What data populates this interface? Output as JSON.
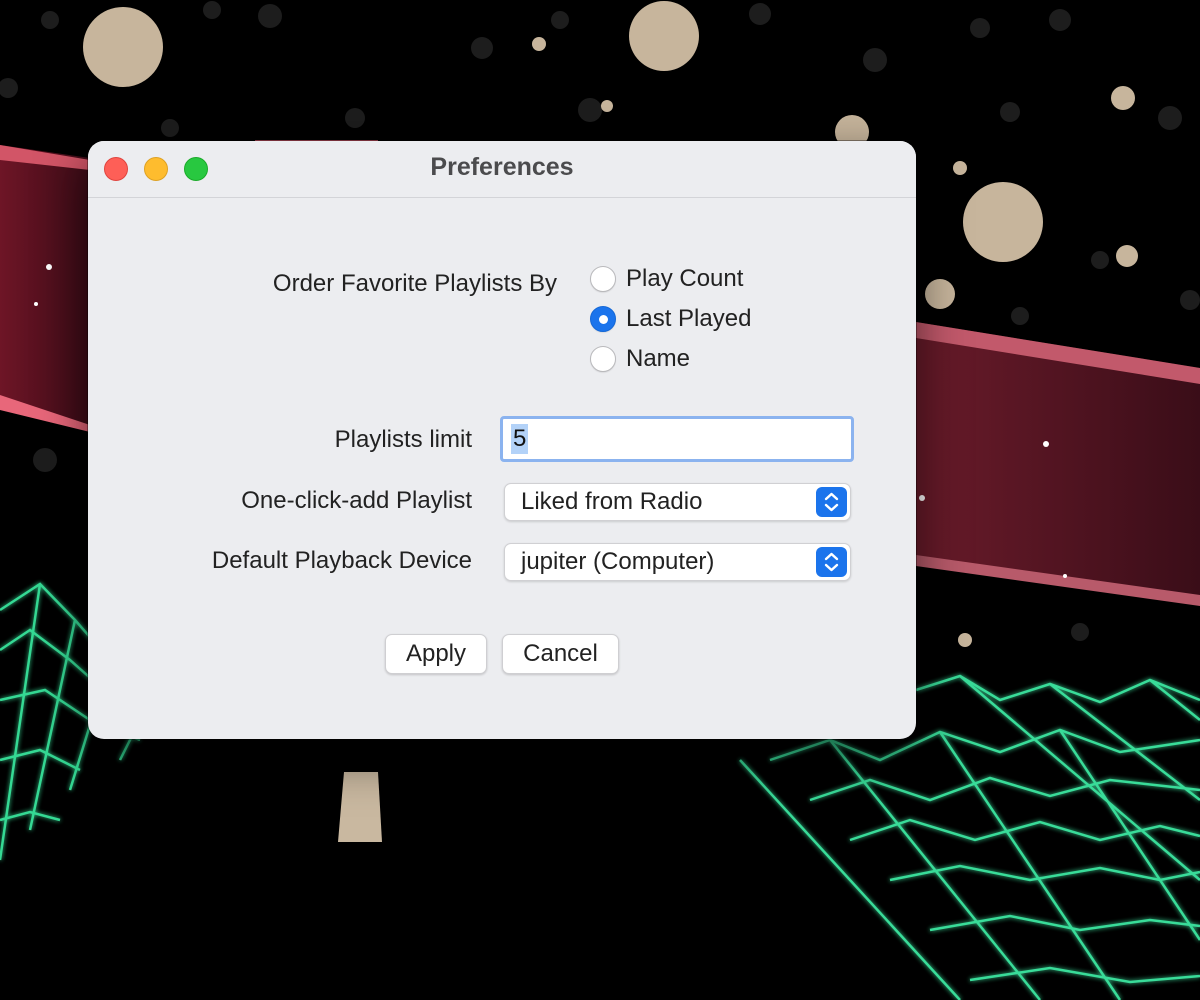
{
  "window": {
    "title": "Preferences"
  },
  "order_by": {
    "label": "Order Favorite Playlists By",
    "options": [
      {
        "label": "Play Count",
        "selected": false
      },
      {
        "label": "Last Played",
        "selected": true
      },
      {
        "label": "Name",
        "selected": false
      }
    ]
  },
  "playlists_limit": {
    "label": "Playlists limit",
    "value": "5"
  },
  "one_click_add": {
    "label": "One-click-add Playlist",
    "value": "Liked from Radio"
  },
  "default_device": {
    "label": "Default Playback Device",
    "value": "jupiter (Computer)"
  },
  "buttons": {
    "apply": "Apply",
    "cancel": "Cancel"
  },
  "colors": {
    "accent": "#1b74ec",
    "window_bg": "#ecedf0",
    "grid_green": "#39e6a0",
    "ribbon_red": "#c03a4e",
    "planet": "#c9b8a0"
  },
  "icons": {
    "close": "close-icon",
    "minimize": "minimize-icon",
    "zoom": "zoom-icon",
    "popup_arrows": "chevron-up-down-icon"
  }
}
